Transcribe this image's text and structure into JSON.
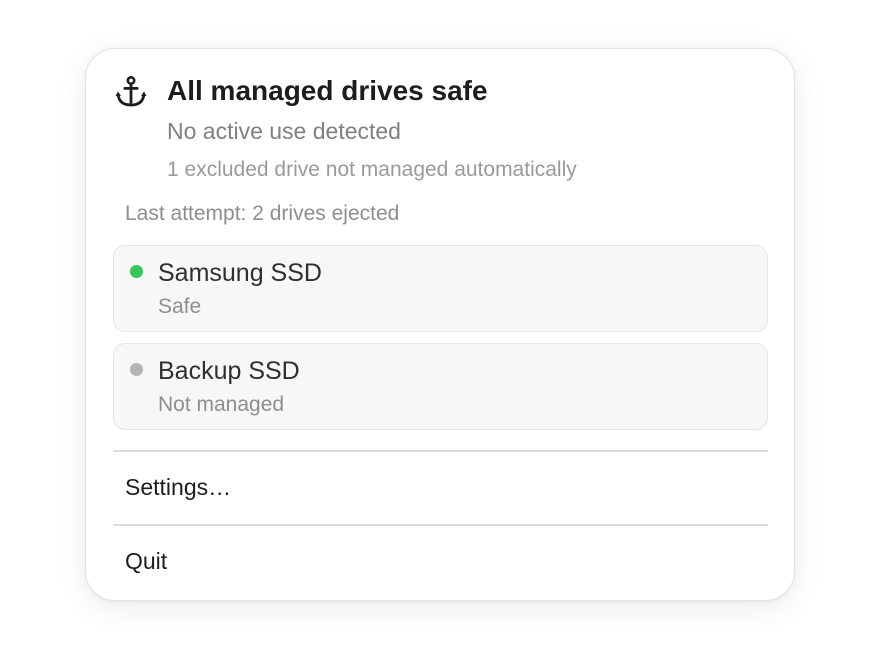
{
  "header": {
    "icon": "anchor-icon",
    "title": "All managed drives safe",
    "subtitle": "No active use detected",
    "excluded_note": "1 excluded drive not managed automatically"
  },
  "last_attempt": "Last attempt: 2 drives ejected",
  "drives": [
    {
      "name": "Samsung SSD",
      "status": "Safe",
      "dot_color": "#34c759"
    },
    {
      "name": "Backup SSD",
      "status": "Not managed",
      "dot_color": "#b5b5b5"
    }
  ],
  "menu": {
    "settings_label": "Settings…",
    "quit_label": "Quit"
  }
}
